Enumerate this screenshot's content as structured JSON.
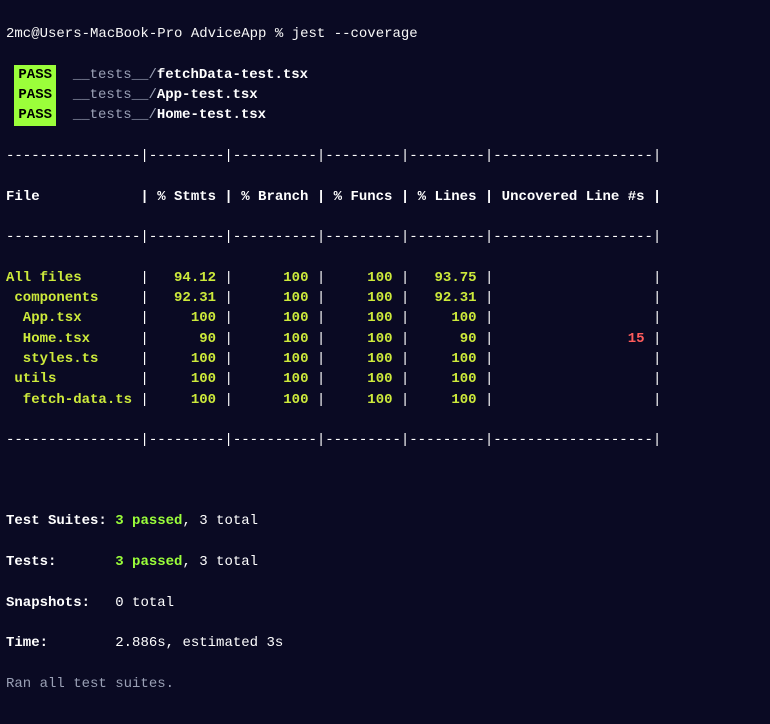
{
  "prompt": {
    "user_host": "2mc@Users-MacBook-Pro",
    "cwd": "AdviceApp",
    "symbol": "%",
    "command": "jest --coverage"
  },
  "pass_badge": "PASS",
  "tests": [
    {
      "dir": "__tests__/",
      "file": "fetchData-test.tsx"
    },
    {
      "dir": "__tests__/",
      "file": "App-test.tsx"
    },
    {
      "dir": "__tests__/",
      "file": "Home-test.tsx"
    }
  ],
  "table": {
    "sep": "----------------|---------|----------|---------|---------|-------------------|",
    "header": {
      "file": "File",
      "stmts": "% Stmts",
      "branch": "% Branch",
      "funcs": "% Funcs",
      "lines": "% Lines",
      "uncov": "Uncovered Line #s"
    },
    "rows": [
      {
        "file": "All files",
        "indent": 0,
        "stmts": "94.12",
        "branch": "100",
        "funcs": "100",
        "lines": "93.75",
        "uncov": ""
      },
      {
        "file": "components",
        "indent": 1,
        "stmts": "92.31",
        "branch": "100",
        "funcs": "100",
        "lines": "92.31",
        "uncov": ""
      },
      {
        "file": "App.tsx",
        "indent": 2,
        "stmts": "100",
        "branch": "100",
        "funcs": "100",
        "lines": "100",
        "uncov": ""
      },
      {
        "file": "Home.tsx",
        "indent": 2,
        "stmts": "90",
        "branch": "100",
        "funcs": "100",
        "lines": "90",
        "uncov": "15"
      },
      {
        "file": "styles.ts",
        "indent": 2,
        "stmts": "100",
        "branch": "100",
        "funcs": "100",
        "lines": "100",
        "uncov": ""
      },
      {
        "file": "utils",
        "indent": 1,
        "stmts": "100",
        "branch": "100",
        "funcs": "100",
        "lines": "100",
        "uncov": ""
      },
      {
        "file": "fetch-data.ts",
        "indent": 2,
        "stmts": "100",
        "branch": "100",
        "funcs": "100",
        "lines": "100",
        "uncov": ""
      }
    ]
  },
  "summary": {
    "suites": {
      "label": "Test Suites:",
      "passed": "3 passed",
      "rest": ", 3 total"
    },
    "tests": {
      "label": "Tests:",
      "passed": "3 passed",
      "rest": ", 3 total"
    },
    "snaps": {
      "label": "Snapshots:",
      "value": "0 total"
    },
    "time": {
      "label": "Time:",
      "value": "2.886s, estimated 3s"
    },
    "ran": "Ran all test suites."
  },
  "chart_data": {
    "type": "table",
    "title": "Jest coverage report",
    "columns": [
      "File",
      "% Stmts",
      "% Branch",
      "% Funcs",
      "% Lines",
      "Uncovered Line #s"
    ],
    "rows": [
      [
        "All files",
        94.12,
        100,
        100,
        93.75,
        ""
      ],
      [
        "components",
        92.31,
        100,
        100,
        92.31,
        ""
      ],
      [
        "App.tsx",
        100,
        100,
        100,
        100,
        ""
      ],
      [
        "Home.tsx",
        90,
        100,
        100,
        90,
        "15"
      ],
      [
        "styles.ts",
        100,
        100,
        100,
        100,
        ""
      ],
      [
        "utils",
        100,
        100,
        100,
        100,
        ""
      ],
      [
        "fetch-data.ts",
        100,
        100,
        100,
        100,
        ""
      ]
    ]
  }
}
